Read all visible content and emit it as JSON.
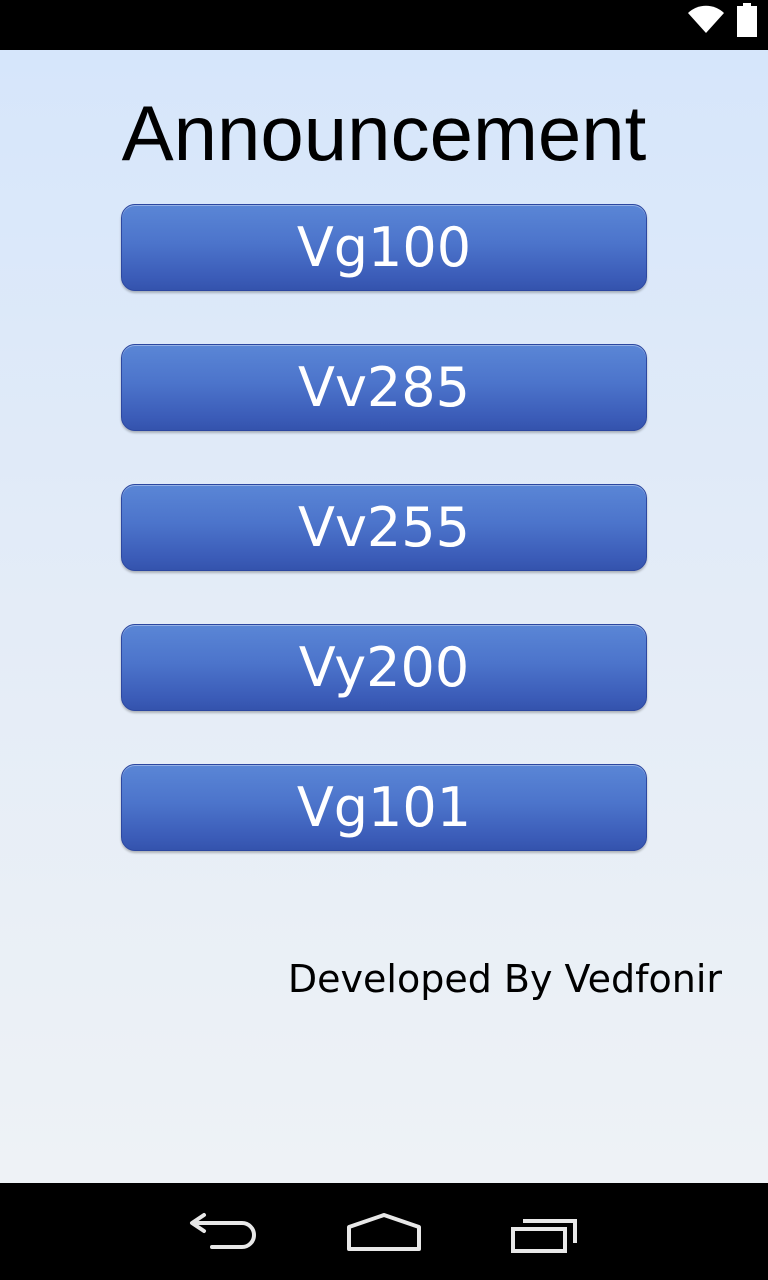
{
  "status_bar": {
    "icons": [
      "wifi-icon",
      "battery-icon"
    ]
  },
  "main": {
    "title": "Announcement",
    "buttons": [
      {
        "label": "Vg100"
      },
      {
        "label": "Vv285"
      },
      {
        "label": "Vv255"
      },
      {
        "label": "Vy200"
      },
      {
        "label": "Vg101"
      }
    ],
    "button_color": "#4c74cb",
    "footer": "Developed By Vedfonir"
  },
  "nav_bar": {
    "icons": [
      "back-icon",
      "home-icon",
      "recents-icon"
    ]
  }
}
